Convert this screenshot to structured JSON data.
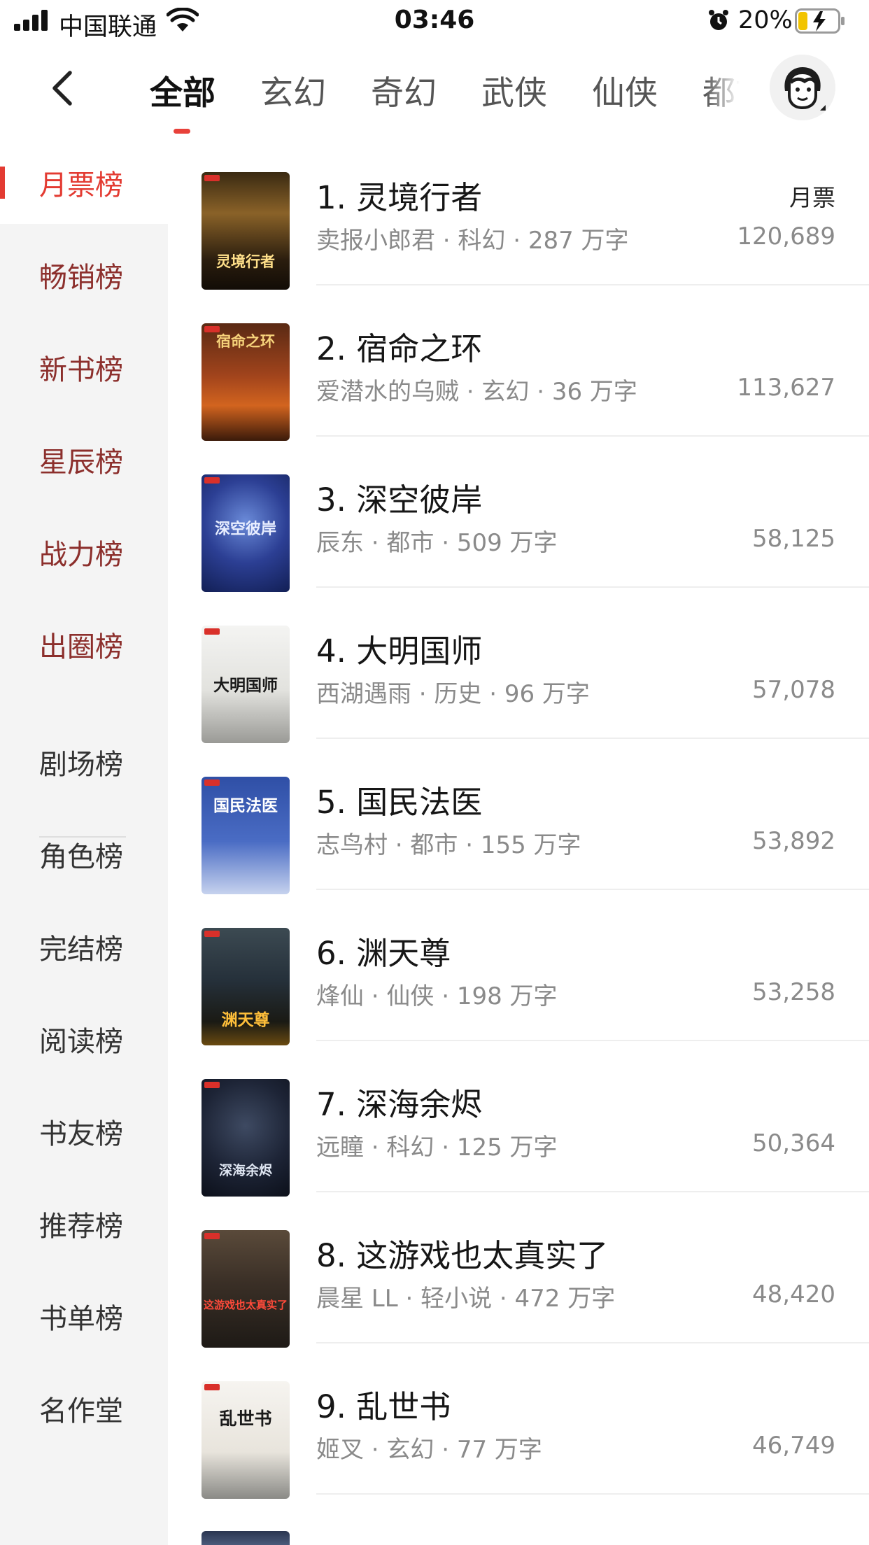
{
  "status_bar": {
    "carrier": "中国联通",
    "time": "03:46",
    "battery": "20%"
  },
  "nav": {
    "tabs": [
      "全部",
      "玄幻",
      "奇幻",
      "武侠",
      "仙侠",
      "都市"
    ],
    "active_tab": "全部"
  },
  "sidebar": {
    "items": [
      "月票榜",
      "畅销榜",
      "新书榜",
      "星辰榜",
      "战力榜",
      "出圈榜",
      "剧场榜",
      "角色榜",
      "完结榜",
      "阅读榜",
      "书友榜",
      "推荐榜",
      "书单榜",
      "名作堂"
    ],
    "active": "月票榜"
  },
  "list": {
    "ticket_label": "月票",
    "books": [
      {
        "title": "1. 灵境行者",
        "meta": "卖报小郎君 · 科幻 · 287 万字",
        "tickets": "120,689",
        "cover_text": "灵境行者"
      },
      {
        "title": "2. 宿命之环",
        "meta": "爱潜水的乌贼 · 玄幻 · 36 万字",
        "tickets": "113,627",
        "cover_text": "宿命之环"
      },
      {
        "title": "3. 深空彼岸",
        "meta": "辰东 · 都市 · 509 万字",
        "tickets": "58,125",
        "cover_text": "深空彼岸"
      },
      {
        "title": "4. 大明国师",
        "meta": "西湖遇雨 · 历史 · 96 万字",
        "tickets": "57,078",
        "cover_text": "大明国师"
      },
      {
        "title": "5. 国民法医",
        "meta": "志鸟村 · 都市 · 155 万字",
        "tickets": "53,892",
        "cover_text": "国民法医"
      },
      {
        "title": "6. 渊天尊",
        "meta": "烽仙 · 仙侠 · 198 万字",
        "tickets": "53,258",
        "cover_text": "渊天尊"
      },
      {
        "title": "7. 深海余烬",
        "meta": "远瞳 · 科幻 · 125 万字",
        "tickets": "50,364",
        "cover_text": "深海余烬"
      },
      {
        "title": "8. 这游戏也太真实了",
        "meta": "晨星 LL · 轻小说 · 472 万字",
        "tickets": "48,420",
        "cover_text": "这游戏也太真实了"
      },
      {
        "title": "9. 乱世书",
        "meta": "姬叉 · 玄幻 · 77 万字",
        "tickets": "46,749",
        "cover_text": "乱世书"
      }
    ]
  },
  "colors": {
    "accent": "#e33b32",
    "sidebar_bg": "#f4f4f4",
    "sidebar_text_red": "#8c2f2c",
    "meta_gray": "#8a8a8a"
  },
  "icons": {
    "back": "chevron-left-icon",
    "avatar": "avatar-icon",
    "wifi": "wifi-icon",
    "alarm": "alarm-icon",
    "battery": "battery-charging-icon",
    "signal": "signal-icon"
  }
}
